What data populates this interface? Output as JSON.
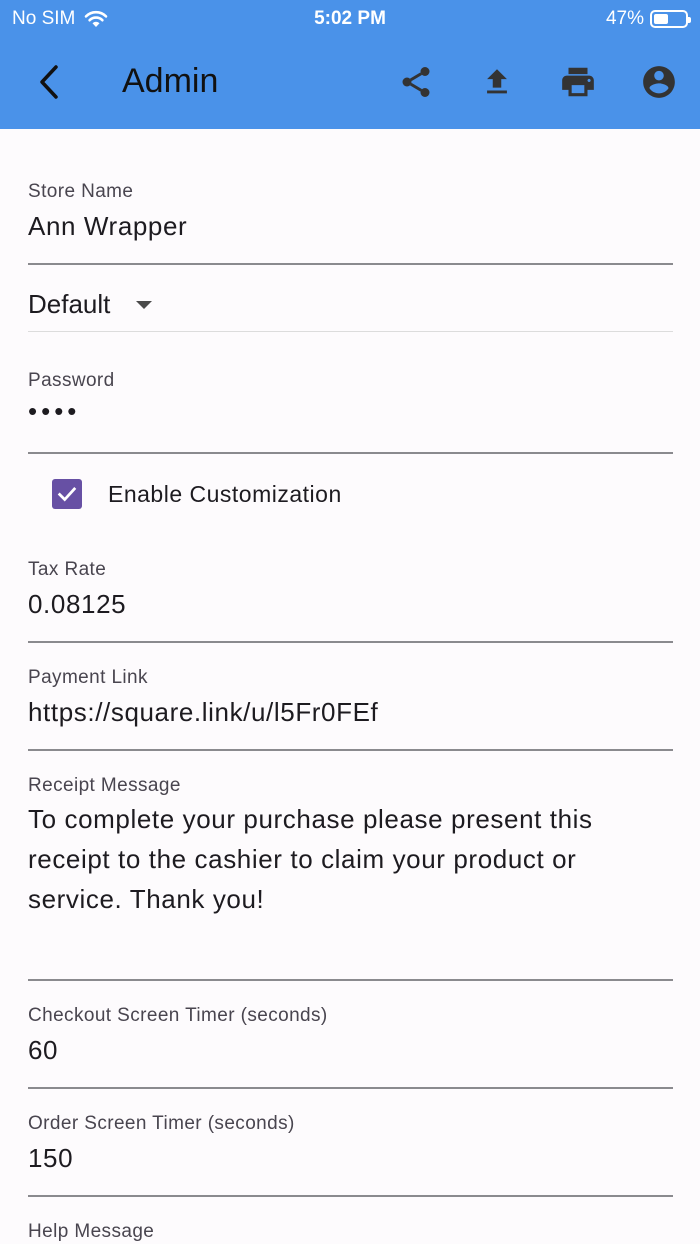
{
  "status_bar": {
    "carrier": "No SIM",
    "time": "5:02 PM",
    "battery_percent": "47%",
    "battery_level": 0.47
  },
  "app_bar": {
    "title": "Admin",
    "icons": [
      "back-arrow-icon",
      "share-icon",
      "upload-icon",
      "print-icon",
      "account-circle-icon"
    ],
    "background": "#4a92e9"
  },
  "form": {
    "store_name": {
      "label": "Store Name",
      "value": "Ann Wrapper"
    },
    "profile_dropdown": {
      "value": "Default"
    },
    "password": {
      "label": "Password",
      "value": "••••"
    },
    "enable_customization": {
      "label": "Enable Customization",
      "checked": true,
      "color": "#6750a4"
    },
    "tax_rate": {
      "label": "Tax Rate",
      "value": "0.08125"
    },
    "payment_link": {
      "label": "Payment Link",
      "value": "https://square.link/u/l5Fr0FEf"
    },
    "receipt_message": {
      "label": "Receipt Message",
      "value": "To complete your purchase please present this receipt to the cashier to claim your product or service. Thank you!"
    },
    "checkout_timer": {
      "label": "Checkout Screen Timer (seconds)",
      "value": "60"
    },
    "order_timer": {
      "label": "Order Screen Timer (seconds)",
      "value": "150"
    },
    "help_message": {
      "label": "Help Message"
    }
  }
}
